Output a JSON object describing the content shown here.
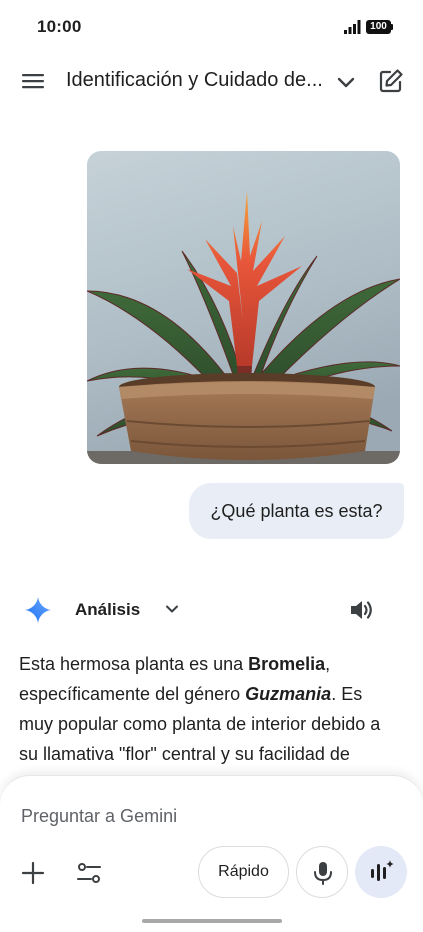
{
  "status_bar": {
    "time": "10:00",
    "battery": "100",
    "icons": [
      "signal-icon",
      "battery-icon"
    ]
  },
  "app_bar": {
    "title": "Identificación y Cuidado de...",
    "icons": [
      "menu-icon",
      "chevron-down-icon",
      "edit-icon"
    ]
  },
  "conversation": {
    "user_prompt": "¿Qué planta es esta?",
    "response": {
      "label": "Análisis",
      "text_parts": {
        "p1": "Esta hermosa planta es una ",
        "p2": "Bromelia",
        "p3": ", específicamente del género ",
        "p4": "Guzmania",
        "p5": ". Es muy popular como planta de interior debido a su llamativa \"flor\" central y su facilidad de"
      },
      "icons": [
        "gemini-icon",
        "chevron-down-icon",
        "speaker-icon"
      ]
    }
  },
  "composer": {
    "placeholder": "Preguntar a Gemini",
    "mode_label": "Rápido",
    "icons": [
      "plus-icon",
      "tools-icon",
      "mic-icon",
      "live-icon"
    ]
  },
  "colors": {
    "user_bubble": "#e9eef6",
    "live_button": "#e3e9f7",
    "gemini_blue": "#4285f4"
  }
}
